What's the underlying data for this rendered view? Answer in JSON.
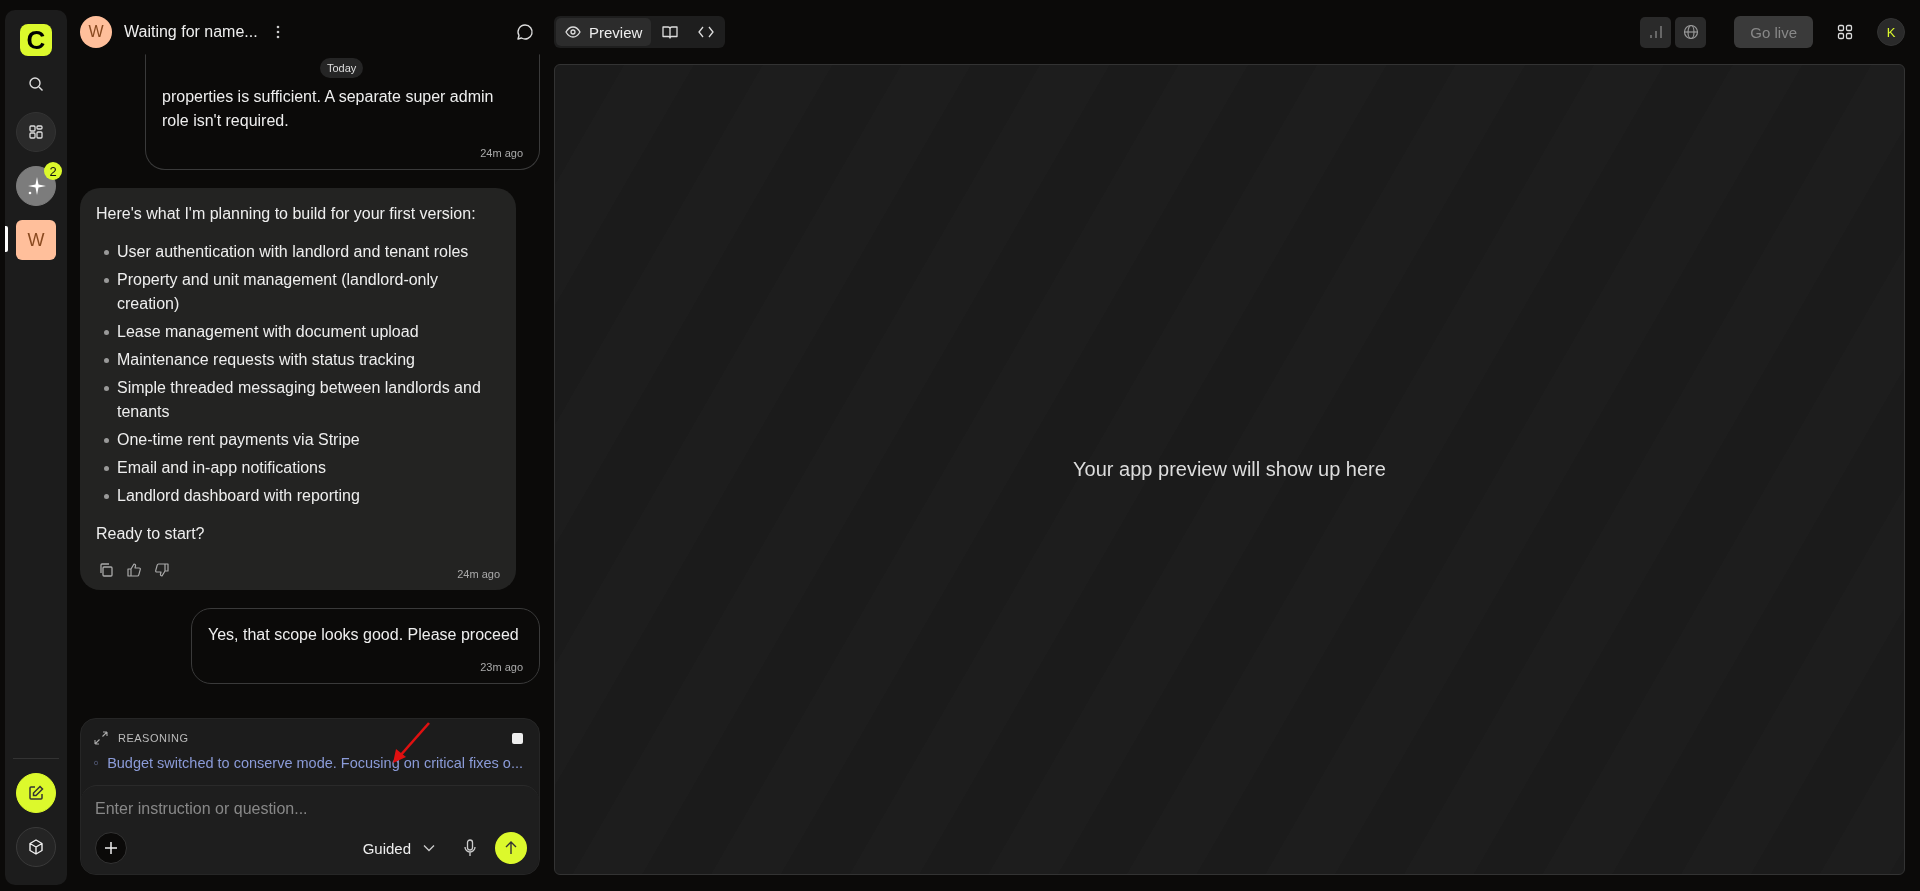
{
  "sidebar": {
    "logo": "C",
    "nav": [
      {
        "kind": "search"
      },
      {
        "kind": "apps"
      },
      {
        "kind": "sparkle",
        "badge": "2"
      }
    ],
    "projects": [
      {
        "initial": "W",
        "selected": true
      }
    ],
    "bottom": [
      {
        "kind": "edit"
      },
      {
        "kind": "cube"
      }
    ]
  },
  "chat_header": {
    "avatar": "W",
    "title": "Waiting for name..."
  },
  "view_tabs": [
    {
      "kind": "preview",
      "label": "Preview",
      "selected": true
    },
    {
      "kind": "docs",
      "selected": false
    },
    {
      "kind": "code",
      "selected": false
    }
  ],
  "top_right": {
    "go_live": {
      "label": "Go live",
      "disabled": true
    },
    "user_avatar": "K"
  },
  "date_badge": "Today",
  "messages": [
    {
      "kind": "user",
      "paragraphs": [
        "properties is sufficient. A separate super admin role isn't required."
      ],
      "time": "24m ago"
    },
    {
      "kind": "assistant",
      "intro": "Here's what I'm planning to build for your first version:",
      "bullets": [
        "User authentication with landlord and tenant roles",
        "Property and unit management (landlord-only creation)",
        "Lease management with document upload",
        "Maintenance requests with status tracking",
        "Simple threaded messaging between landlords and tenants",
        "One-time rent payments via Stripe",
        "Email and in-app notifications",
        "Landlord dashboard with reporting"
      ],
      "outro": "Ready to start?",
      "time": "24m ago"
    },
    {
      "kind": "user",
      "paragraphs": [
        "Yes, that scope looks good. Please proceed"
      ],
      "time": "23m ago"
    }
  ],
  "reasoning": {
    "label": "REASONING",
    "text": "Budget switched to conserve mode. Focusing on critical fixes o..."
  },
  "composer": {
    "placeholder": "Enter instruction or question...",
    "mode": "Guided"
  },
  "preview": {
    "message": "Your app preview will show up here"
  }
}
